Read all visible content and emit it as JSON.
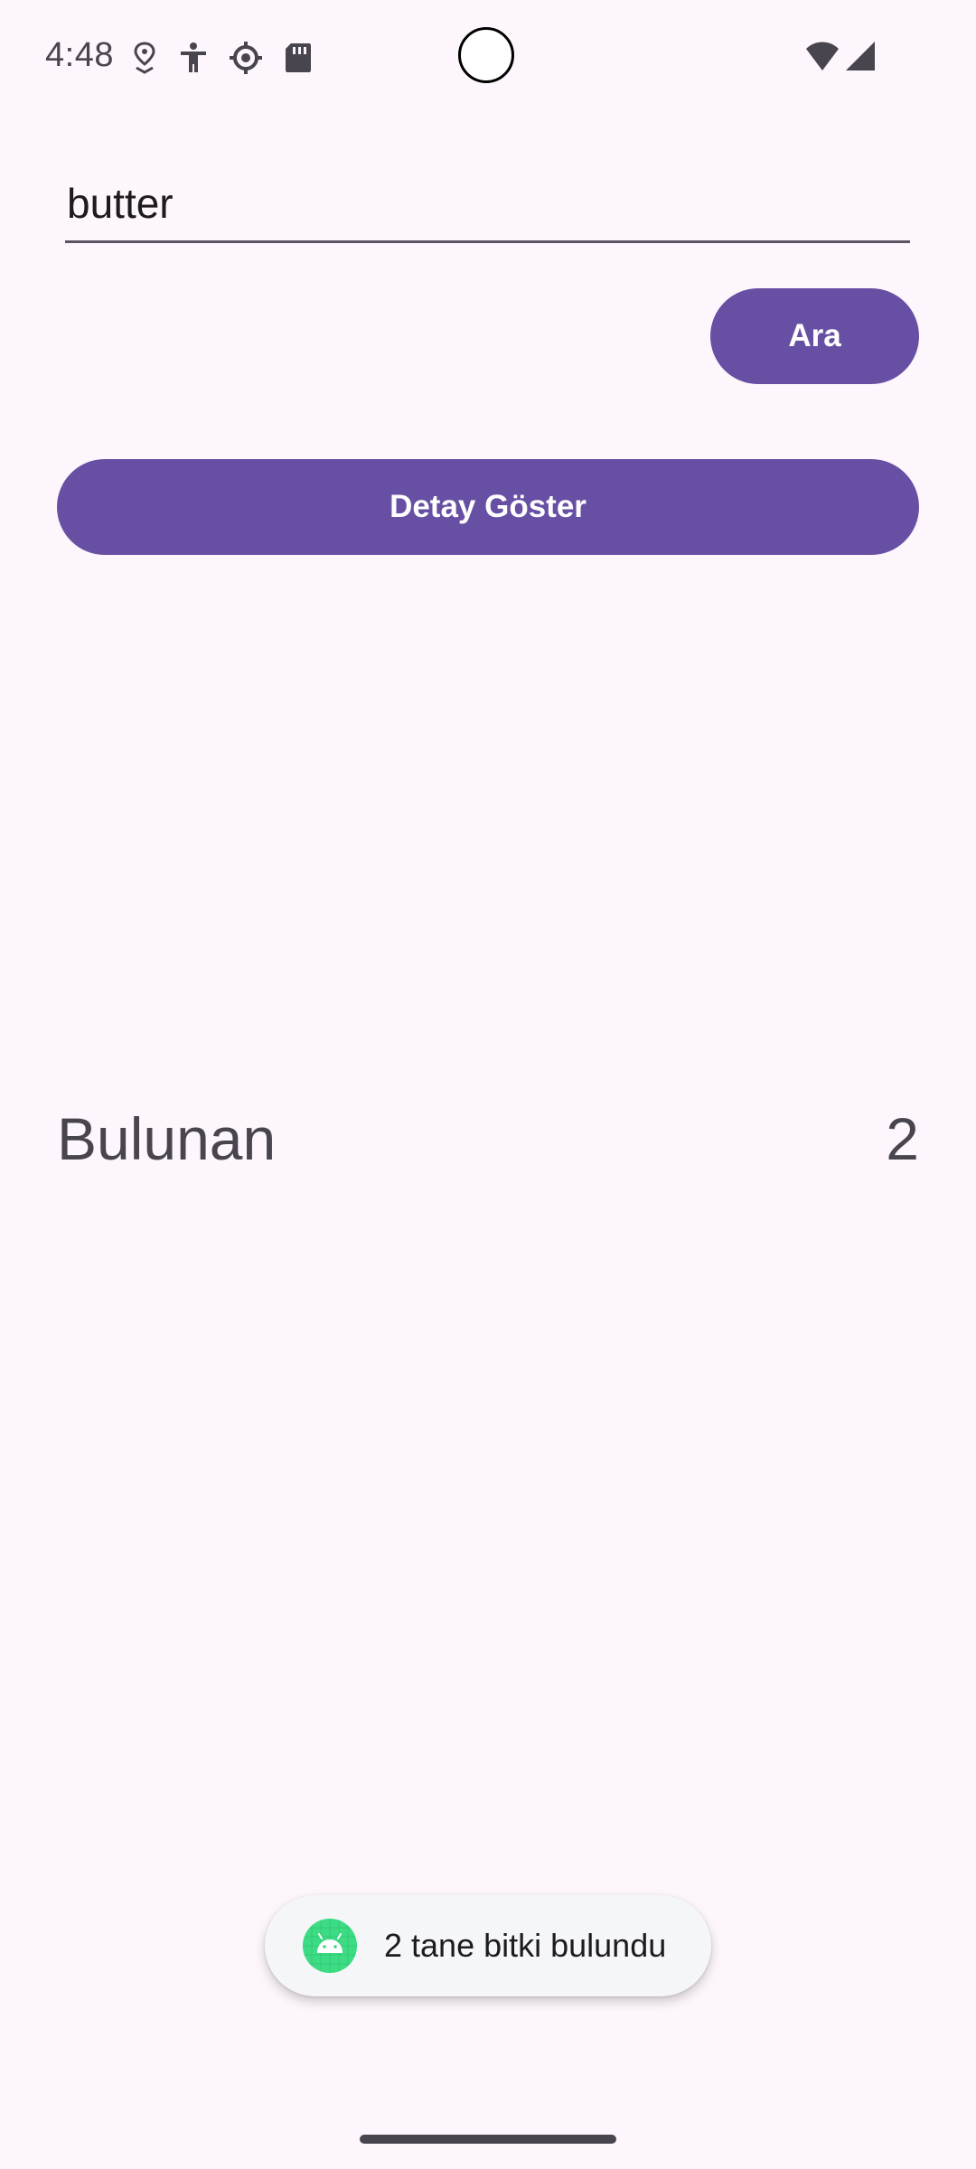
{
  "status_bar": {
    "time": "4:48",
    "icons": [
      "location-pin-icon",
      "accessibility-icon",
      "system-settings-icon",
      "sd-card-icon",
      "wifi-icon",
      "cell-signal-icon"
    ]
  },
  "search": {
    "value": "butter",
    "button_label": "Ara"
  },
  "detail": {
    "button_label": "Detay Göster"
  },
  "result": {
    "label": "Bulunan",
    "count": "2"
  },
  "toast": {
    "message": "2 tane bitki bulundu",
    "icon": "android-icon"
  },
  "colors": {
    "background": "#fdf6fc",
    "primary": "#6750a4",
    "on_primary": "#ffffff",
    "text_secondary": "#49454f",
    "toast_icon": "#3ddc84"
  }
}
